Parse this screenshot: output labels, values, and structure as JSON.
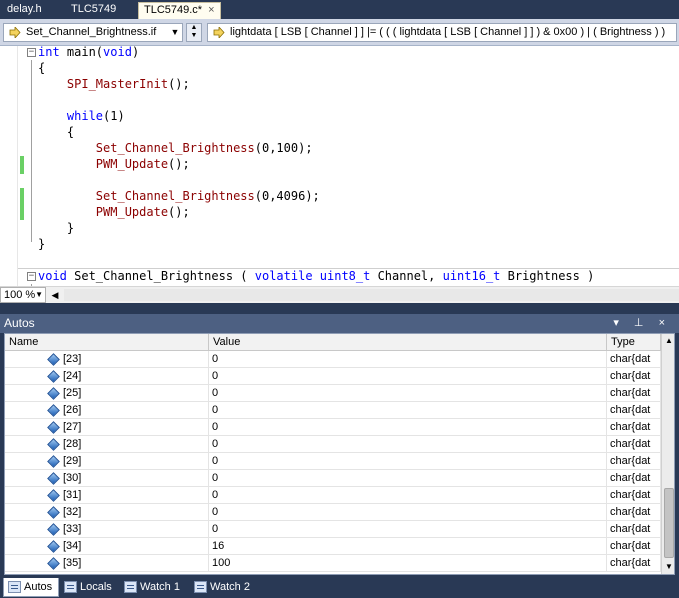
{
  "document_tabs": [
    {
      "label": "delay.h",
      "active": false
    },
    {
      "label": "TLC5749",
      "active": false
    },
    {
      "label": "TLC5749.c*",
      "active": true
    }
  ],
  "tab_close_glyph": "×",
  "navigation": {
    "scope_combo": "Set_Channel_Brightness.if",
    "member_combo": "lightdata [ LSB [ Channel ] ] |= ( ( ( lightdata [ LSB [ Channel ] ] ) & 0x00 ) | ( Brightness ) )"
  },
  "code": {
    "lines": [
      {
        "fold": "−",
        "segs": [
          {
            "t": "int",
            "c": "kw"
          },
          {
            "t": " main(",
            "c": ""
          },
          {
            "t": "void",
            "c": "kw"
          },
          {
            "t": ")",
            "c": ""
          }
        ]
      },
      {
        "segs": [
          {
            "t": "{",
            "c": ""
          }
        ]
      },
      {
        "segs": [
          {
            "t": "    ",
            "c": ""
          },
          {
            "t": "SPI_MasterInit",
            "c": "fn"
          },
          {
            "t": "();",
            "c": ""
          }
        ]
      },
      {
        "segs": []
      },
      {
        "segs": [
          {
            "t": "    ",
            "c": ""
          },
          {
            "t": "while",
            "c": "kw"
          },
          {
            "t": "(1)",
            "c": ""
          }
        ]
      },
      {
        "segs": [
          {
            "t": "    {",
            "c": ""
          }
        ]
      },
      {
        "segs": [
          {
            "t": "        ",
            "c": ""
          },
          {
            "t": "Set_Channel_Brightness",
            "c": "fn"
          },
          {
            "t": "(0,100);",
            "c": ""
          }
        ]
      },
      {
        "segs": [
          {
            "t": "        ",
            "c": ""
          },
          {
            "t": "PWM_Update",
            "c": "fn"
          },
          {
            "t": "();",
            "c": ""
          }
        ]
      },
      {
        "segs": []
      },
      {
        "segs": [
          {
            "t": "        ",
            "c": ""
          },
          {
            "t": "Set_Channel_Brightness",
            "c": "fn"
          },
          {
            "t": "(0,4096);",
            "c": ""
          }
        ]
      },
      {
        "segs": [
          {
            "t": "        ",
            "c": ""
          },
          {
            "t": "PWM_Update",
            "c": "fn"
          },
          {
            "t": "();",
            "c": ""
          }
        ]
      },
      {
        "segs": [
          {
            "t": "    }",
            "c": ""
          }
        ]
      },
      {
        "segs": [
          {
            "t": "}",
            "c": ""
          }
        ]
      },
      {
        "segs": []
      },
      {
        "fold": "−",
        "segs": [
          {
            "t": "void",
            "c": "kw"
          },
          {
            "t": " Set_Channel_Brightness ( ",
            "c": ""
          },
          {
            "t": "volatile",
            "c": "kw"
          },
          {
            "t": " ",
            "c": ""
          },
          {
            "t": "uint8_t",
            "c": "kw"
          },
          {
            "t": " Channel, ",
            "c": ""
          },
          {
            "t": "uint16_t",
            "c": "kw"
          },
          {
            "t": " Brightness )",
            "c": ""
          }
        ]
      }
    ]
  },
  "zoom": {
    "value": "100 %"
  },
  "autos": {
    "title": "Autos",
    "header_controls": "▾ ⊥ ×",
    "columns": [
      "Name",
      "Value",
      "Type"
    ],
    "rows": [
      {
        "name": "[23]",
        "value": "0",
        "type": "char{dat"
      },
      {
        "name": "[24]",
        "value": "0",
        "type": "char{dat"
      },
      {
        "name": "[25]",
        "value": "0",
        "type": "char{dat"
      },
      {
        "name": "[26]",
        "value": "0",
        "type": "char{dat"
      },
      {
        "name": "[27]",
        "value": "0",
        "type": "char{dat"
      },
      {
        "name": "[28]",
        "value": "0",
        "type": "char{dat"
      },
      {
        "name": "[29]",
        "value": "0",
        "type": "char{dat"
      },
      {
        "name": "[30]",
        "value": "0",
        "type": "char{dat"
      },
      {
        "name": "[31]",
        "value": "0",
        "type": "char{dat"
      },
      {
        "name": "[32]",
        "value": "0",
        "type": "char{dat"
      },
      {
        "name": "[33]",
        "value": "0",
        "type": "char{dat"
      },
      {
        "name": "[34]",
        "value": "16",
        "type": "char{dat"
      },
      {
        "name": "[35]",
        "value": "100",
        "type": "char{dat"
      }
    ]
  },
  "bottom_tabs": [
    {
      "label": "Autos",
      "active": true
    },
    {
      "label": "Locals",
      "active": false
    },
    {
      "label": "Watch 1",
      "active": false
    },
    {
      "label": "Watch 2",
      "active": false
    }
  ]
}
